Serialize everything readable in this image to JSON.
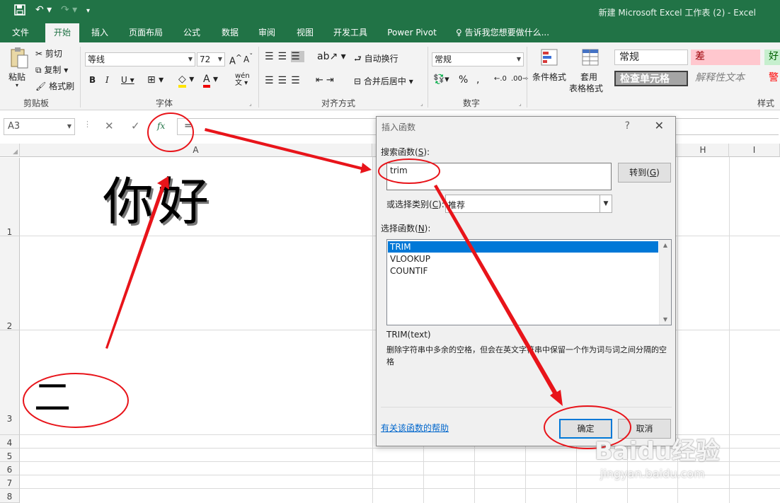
{
  "app": {
    "title": "新建 Microsoft Excel 工作表 (2) - Excel"
  },
  "tabs": [
    "文件",
    "开始",
    "插入",
    "页面布局",
    "公式",
    "数据",
    "审阅",
    "视图",
    "开发工具",
    "Power Pivot"
  ],
  "tell_me": "告诉我您想要做什么...",
  "ribbon": {
    "clipboard": {
      "label": "剪贴板",
      "paste": "粘贴",
      "cut": "剪切",
      "copy": "复制",
      "format_painter": "格式刷"
    },
    "font": {
      "label": "字体",
      "name": "等线",
      "size": "72"
    },
    "alignment": {
      "label": "对齐方式",
      "wrap": "自动换行",
      "merge": "合并后居中"
    },
    "number": {
      "label": "数字",
      "format": "常规"
    },
    "styles": {
      "label": "样式",
      "cond_format": "条件格式",
      "table_format_1": "套用",
      "table_format_2": "表格格式",
      "normal": "常规",
      "bad": "差",
      "good": "好",
      "check_cell": "检查单元格",
      "explanatory": "解释性文本",
      "warning": "警"
    }
  },
  "formula_bar": {
    "namebox": "A3",
    "content": "="
  },
  "grid": {
    "columns": [
      "A",
      "H",
      "I"
    ],
    "rows": [
      "1",
      "2",
      "3",
      "4",
      "5",
      "6",
      "7",
      "8"
    ],
    "a1_text": "你好",
    "a3_text": "二"
  },
  "dialog": {
    "title": "插入函数",
    "help": "?",
    "search_label_prefix": "搜索函数(",
    "search_label_key": "S",
    "search_label_suffix": "):",
    "search_value": "trim",
    "go_button_prefix": "转到(",
    "go_button_key": "G",
    "go_button_suffix": ")",
    "category_label_prefix": "或选择类别(",
    "category_label_key": "C",
    "category_label_suffix": "):",
    "category_value": "推荐",
    "select_label_prefix": "选择函数(",
    "select_label_key": "N",
    "select_label_suffix": "):",
    "functions": [
      "TRIM",
      "VLOOKUP",
      "COUNTIF"
    ],
    "signature": "TRIM(text)",
    "description": "删除字符串中多余的空格，但会在英文字符串中保留一个作为词与词之间分隔的空格",
    "help_link": "有关该函数的帮助",
    "ok": "确定",
    "cancel": "取消"
  },
  "watermark": {
    "brand": "Baidu经验",
    "url": "jingyan.baidu.com"
  },
  "colors": {
    "excel_green": "#217346",
    "annotation_red": "#e8141a",
    "select_blue": "#0078d7"
  }
}
